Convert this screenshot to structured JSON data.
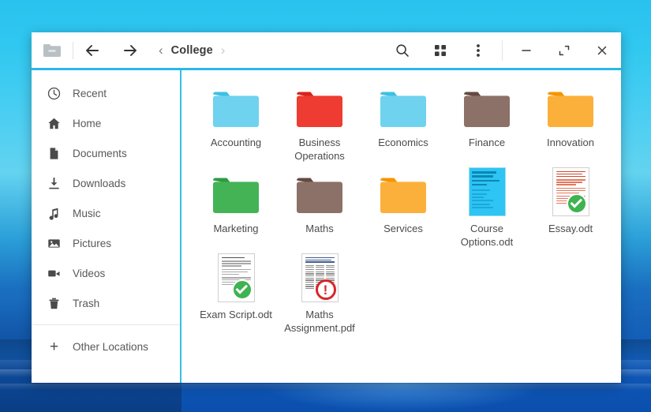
{
  "window": {
    "title": "College",
    "app_icon": "folder-icon"
  },
  "toolbar": {
    "back_label": "←",
    "forward_label": "→",
    "path_prev_label": "‹",
    "path_current": "College",
    "path_next_label": "›",
    "search_label": "search-icon",
    "view_grid_label": "grid-view-icon",
    "menu_label": "more-options-icon",
    "minimize_label": "–",
    "maximize_label": "maximize-icon",
    "close_label": "✕"
  },
  "sidebar": {
    "items": [
      {
        "label": "Recent",
        "icon": "clock-icon"
      },
      {
        "label": "Home",
        "icon": "home-icon"
      },
      {
        "label": "Documents",
        "icon": "document-icon"
      },
      {
        "label": "Downloads",
        "icon": "download-icon"
      },
      {
        "label": "Music",
        "icon": "music-note-icon"
      },
      {
        "label": "Pictures",
        "icon": "picture-icon"
      },
      {
        "label": "Videos",
        "icon": "video-camera-icon"
      },
      {
        "label": "Trash",
        "icon": "trash-icon"
      }
    ],
    "other_locations": {
      "label": "Other Locations",
      "icon": "plus-icon"
    }
  },
  "files": [
    {
      "name": "Accounting",
      "type": "folder",
      "color": "#6fd2ee",
      "tab_color": "#3cc0e3"
    },
    {
      "name": "Business Operations",
      "type": "folder",
      "color": "#ef3c32",
      "tab_color": "#d8241c"
    },
    {
      "name": "Economics",
      "type": "folder",
      "color": "#6fd2ee",
      "tab_color": "#3cc0e3"
    },
    {
      "name": "Finance",
      "type": "folder",
      "color": "#8b7168",
      "tab_color": "#65493f"
    },
    {
      "name": "Innovation",
      "type": "folder",
      "color": "#fbb03b",
      "tab_color": "#f79400"
    },
    {
      "name": "Marketing",
      "type": "folder",
      "color": "#44b356",
      "tab_color": "#2d9b41"
    },
    {
      "name": "Maths",
      "type": "folder",
      "color": "#8b7168",
      "tab_color": "#65493f"
    },
    {
      "name": "Services",
      "type": "folder",
      "color": "#fbb03b",
      "tab_color": "#f79400"
    },
    {
      "name": "Course Options.odt",
      "type": "odt-blue",
      "badge": "none"
    },
    {
      "name": "Essay.odt",
      "type": "odt-essay",
      "badge": "ok"
    },
    {
      "name": "Exam Script.odt",
      "type": "odt-exam",
      "badge": "ok"
    },
    {
      "name": "Maths Assignment.pdf",
      "type": "pdf",
      "badge": "warn"
    }
  ],
  "thumbnail_text": {
    "course_options": [
      "Clean Harbors Inc.",
      "Finance Project Group 60"
    ]
  },
  "colors": {
    "accent": "#29b8e8",
    "sidebar_divider": "#34bfe8",
    "badge_ok": "#3eb34f",
    "badge_warn": "#d8262a",
    "desktop_top": "#29c2ef",
    "desktop_bottom": "#0b4fae"
  }
}
